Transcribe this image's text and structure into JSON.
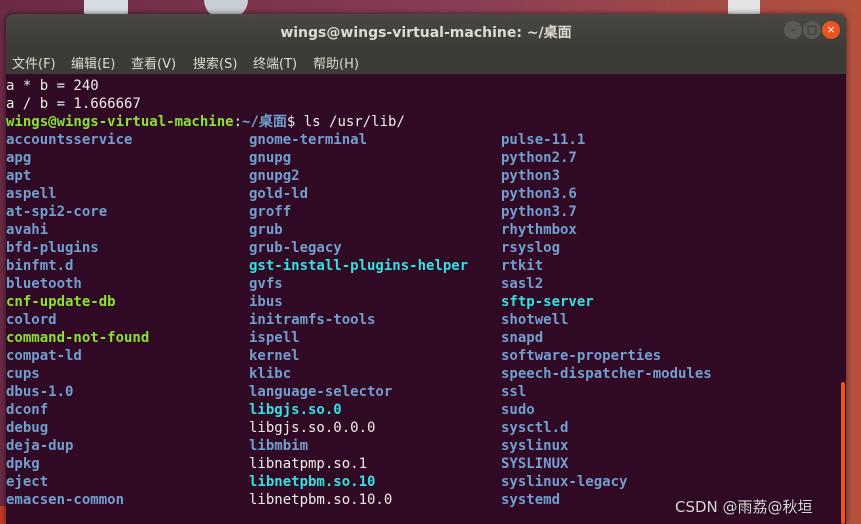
{
  "window": {
    "title": "wings@wings-virtual-machine: ~/桌面",
    "buttons": {
      "minimize": "–",
      "maximize": "□",
      "close": "×"
    }
  },
  "menu": [
    "文件(F)",
    "编辑(E)",
    "查看(V)",
    "搜索(S)",
    "终端(T)",
    "帮助(H)"
  ],
  "terminal": {
    "output_lines": [
      "a * b = 240",
      "a / b = 1.666667"
    ],
    "prompt_user": "wings@wings-virtual-machine",
    "prompt_sep": ":",
    "prompt_path": "~/桌面",
    "prompt_symbol": "$ ",
    "command": "ls /usr/lib/",
    "listing": [
      [
        {
          "name": "accountsservice",
          "kind": "dir"
        },
        {
          "name": "apg",
          "kind": "dir"
        },
        {
          "name": "apt",
          "kind": "dir"
        },
        {
          "name": "aspell",
          "kind": "dir"
        },
        {
          "name": "at-spi2-core",
          "kind": "dir"
        },
        {
          "name": "avahi",
          "kind": "dir"
        },
        {
          "name": "bfd-plugins",
          "kind": "dir"
        },
        {
          "name": "binfmt.d",
          "kind": "dir"
        },
        {
          "name": "bluetooth",
          "kind": "dir"
        },
        {
          "name": "cnf-update-db",
          "kind": "exec"
        },
        {
          "name": "colord",
          "kind": "dir"
        },
        {
          "name": "command-not-found",
          "kind": "exec"
        },
        {
          "name": "compat-ld",
          "kind": "dir"
        },
        {
          "name": "cups",
          "kind": "dir"
        },
        {
          "name": "dbus-1.0",
          "kind": "dir"
        },
        {
          "name": "dconf",
          "kind": "dir"
        },
        {
          "name": "debug",
          "kind": "dir"
        },
        {
          "name": "deja-dup",
          "kind": "dir"
        },
        {
          "name": "dpkg",
          "kind": "dir"
        },
        {
          "name": "eject",
          "kind": "dir"
        },
        {
          "name": "emacsen-common",
          "kind": "dir"
        }
      ],
      [
        {
          "name": "gnome-terminal",
          "kind": "dir"
        },
        {
          "name": "gnupg",
          "kind": "dir"
        },
        {
          "name": "gnupg2",
          "kind": "dir"
        },
        {
          "name": "gold-ld",
          "kind": "dir"
        },
        {
          "name": "groff",
          "kind": "dir"
        },
        {
          "name": "grub",
          "kind": "dir"
        },
        {
          "name": "grub-legacy",
          "kind": "dir"
        },
        {
          "name": "gst-install-plugins-helper",
          "kind": "link"
        },
        {
          "name": "gvfs",
          "kind": "dir"
        },
        {
          "name": "ibus",
          "kind": "dir"
        },
        {
          "name": "initramfs-tools",
          "kind": "dir"
        },
        {
          "name": "ispell",
          "kind": "dir"
        },
        {
          "name": "kernel",
          "kind": "dir"
        },
        {
          "name": "klibc",
          "kind": "dir"
        },
        {
          "name": "language-selector",
          "kind": "dir"
        },
        {
          "name": "libgjs.so.0",
          "kind": "link"
        },
        {
          "name": "libgjs.so.0.0.0",
          "kind": "file"
        },
        {
          "name": "libmbim",
          "kind": "dir"
        },
        {
          "name": "libnatpmp.so.1",
          "kind": "file"
        },
        {
          "name": "libnetpbm.so.10",
          "kind": "link"
        },
        {
          "name": "libnetpbm.so.10.0",
          "kind": "file"
        }
      ],
      [
        {
          "name": "pulse-11.1",
          "kind": "dir"
        },
        {
          "name": "python2.7",
          "kind": "dir"
        },
        {
          "name": "python3",
          "kind": "dir"
        },
        {
          "name": "python3.6",
          "kind": "dir"
        },
        {
          "name": "python3.7",
          "kind": "dir"
        },
        {
          "name": "rhythmbox",
          "kind": "dir"
        },
        {
          "name": "rsyslog",
          "kind": "dir"
        },
        {
          "name": "rtkit",
          "kind": "dir"
        },
        {
          "name": "sasl2",
          "kind": "dir"
        },
        {
          "name": "sftp-server",
          "kind": "link"
        },
        {
          "name": "shotwell",
          "kind": "dir"
        },
        {
          "name": "snapd",
          "kind": "dir"
        },
        {
          "name": "software-properties",
          "kind": "dir"
        },
        {
          "name": "speech-dispatcher-modules",
          "kind": "dir"
        },
        {
          "name": "ssl",
          "kind": "dir"
        },
        {
          "name": "sudo",
          "kind": "dir"
        },
        {
          "name": "sysctl.d",
          "kind": "dir"
        },
        {
          "name": "syslinux",
          "kind": "dir"
        },
        {
          "name": "SYSLINUX",
          "kind": "dir"
        },
        {
          "name": "syslinux-legacy",
          "kind": "dir"
        },
        {
          "name": "systemd",
          "kind": "dir"
        }
      ]
    ]
  },
  "watermark": "CSDN @雨荔@秋垣",
  "colors": {
    "terminal_bg": "#300a24",
    "dir": "#729fcf",
    "exec": "#8ae234",
    "link": "#34e2e2",
    "file": "#eeeeec",
    "close_button": "#e95420"
  }
}
